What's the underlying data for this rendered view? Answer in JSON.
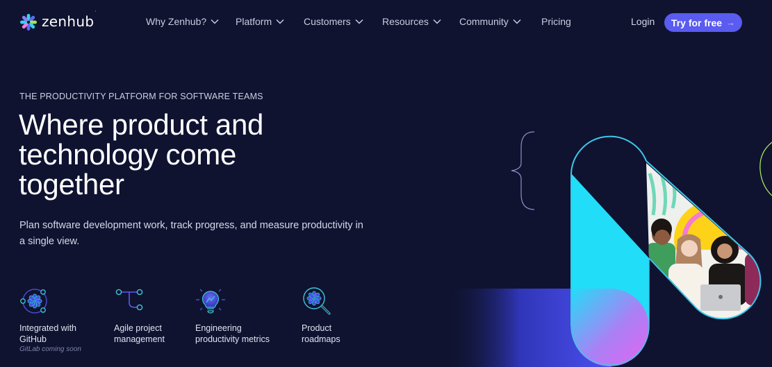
{
  "brand": {
    "name": "zenhub",
    "trademark": "ˈ"
  },
  "nav": {
    "items": [
      {
        "label": "Why Zenhub?",
        "has_dropdown": true
      },
      {
        "label": "Platform",
        "has_dropdown": true
      },
      {
        "label": "Customers",
        "has_dropdown": true
      },
      {
        "label": "Resources",
        "has_dropdown": true
      },
      {
        "label": "Community",
        "has_dropdown": true
      },
      {
        "label": "Pricing",
        "has_dropdown": false
      }
    ],
    "login": "Login",
    "cta": {
      "label": "Try for free",
      "icon": "arrow-right-icon"
    }
  },
  "hero": {
    "eyebrow": "THE PRODUCTIVITY PLATFORM FOR SOFTWARE TEAMS",
    "headline": [
      "Where product and",
      "technology come",
      "together"
    ],
    "subtext": [
      "Plan software development work, track progress, and measure productivity in",
      "a single view."
    ]
  },
  "features": [
    {
      "icon": "github-integration-icon",
      "label": [
        "Integrated with",
        "GitHub"
      ],
      "note": "GitLab coming soon"
    },
    {
      "icon": "branch-icon",
      "label": [
        "Agile project",
        "management"
      ]
    },
    {
      "icon": "lightbulb-chart-icon",
      "label": [
        "Engineering",
        "productivity metrics"
      ]
    },
    {
      "icon": "magnifier-icon",
      "label": [
        "Product",
        "roadmaps"
      ]
    }
  ],
  "colors": {
    "background": "#0f1330",
    "accent": "#5a5bf0",
    "cyan": "#22ddf7",
    "pink": "#f05ef0",
    "nav_text": "#c9cce0"
  }
}
